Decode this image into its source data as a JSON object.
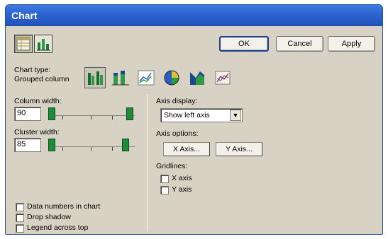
{
  "window": {
    "title": "Chart"
  },
  "tabs": [
    {
      "icon": "table-view-icon"
    },
    {
      "icon": "chart-view-icon"
    }
  ],
  "buttons": {
    "ok": "OK",
    "cancel": "Cancel",
    "apply": "Apply"
  },
  "chart_type": {
    "label_line1": "Chart type:",
    "label_line2": "Grouped column",
    "icons": [
      "grouped-column-icon",
      "stacked-column-icon",
      "line-chart-icon",
      "pie-chart-icon",
      "area-chart-icon",
      "3d-chart-icon"
    ],
    "selected": "grouped-column-icon"
  },
  "column_width": {
    "label": "Column width:",
    "value": "90",
    "level_percent": 100
  },
  "cluster_width": {
    "label": "Cluster width:",
    "value": "85",
    "level_percent": 85
  },
  "axis_display": {
    "label": "Axis display:",
    "selected": "Show left axis"
  },
  "axis_options": {
    "label": "Axis options:",
    "x_button": "X Axis...",
    "y_button": "Y Axis..."
  },
  "gridlines": {
    "label": "Gridlines:",
    "x_axis": "X axis",
    "y_axis": "Y axis"
  },
  "checkboxes": {
    "data_numbers": "Data numbers in chart",
    "drop_shadow": "Drop shadow",
    "legend": "Legend across top"
  },
  "colors": {
    "titlebar": "#2b63cf",
    "dialog_bg": "#d7d2c3",
    "slider_thumb": "#1f8a3a"
  }
}
